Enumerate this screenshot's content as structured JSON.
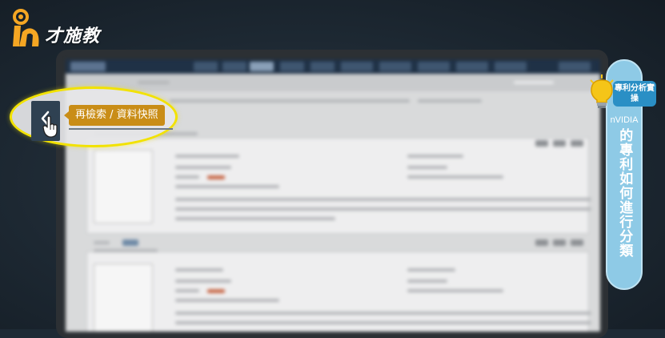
{
  "logo": {
    "text": "才施教",
    "accent_color": "#f5a623"
  },
  "callout": {
    "tooltip": "再檢索 / 資料快照",
    "icon_chevron": "chevron-left-icon",
    "icon_cursor": "hand-pointer-icon",
    "highlight_color": "#f2e200",
    "tooltip_color": "#c98d17"
  },
  "banner": {
    "tag": "專利分析實操",
    "brand": "nVIDIA",
    "title": "的專利如何進行分類",
    "color": "#8ecae6",
    "tag_color": "#2a8fc5",
    "icon": "lightbulb-icon"
  }
}
